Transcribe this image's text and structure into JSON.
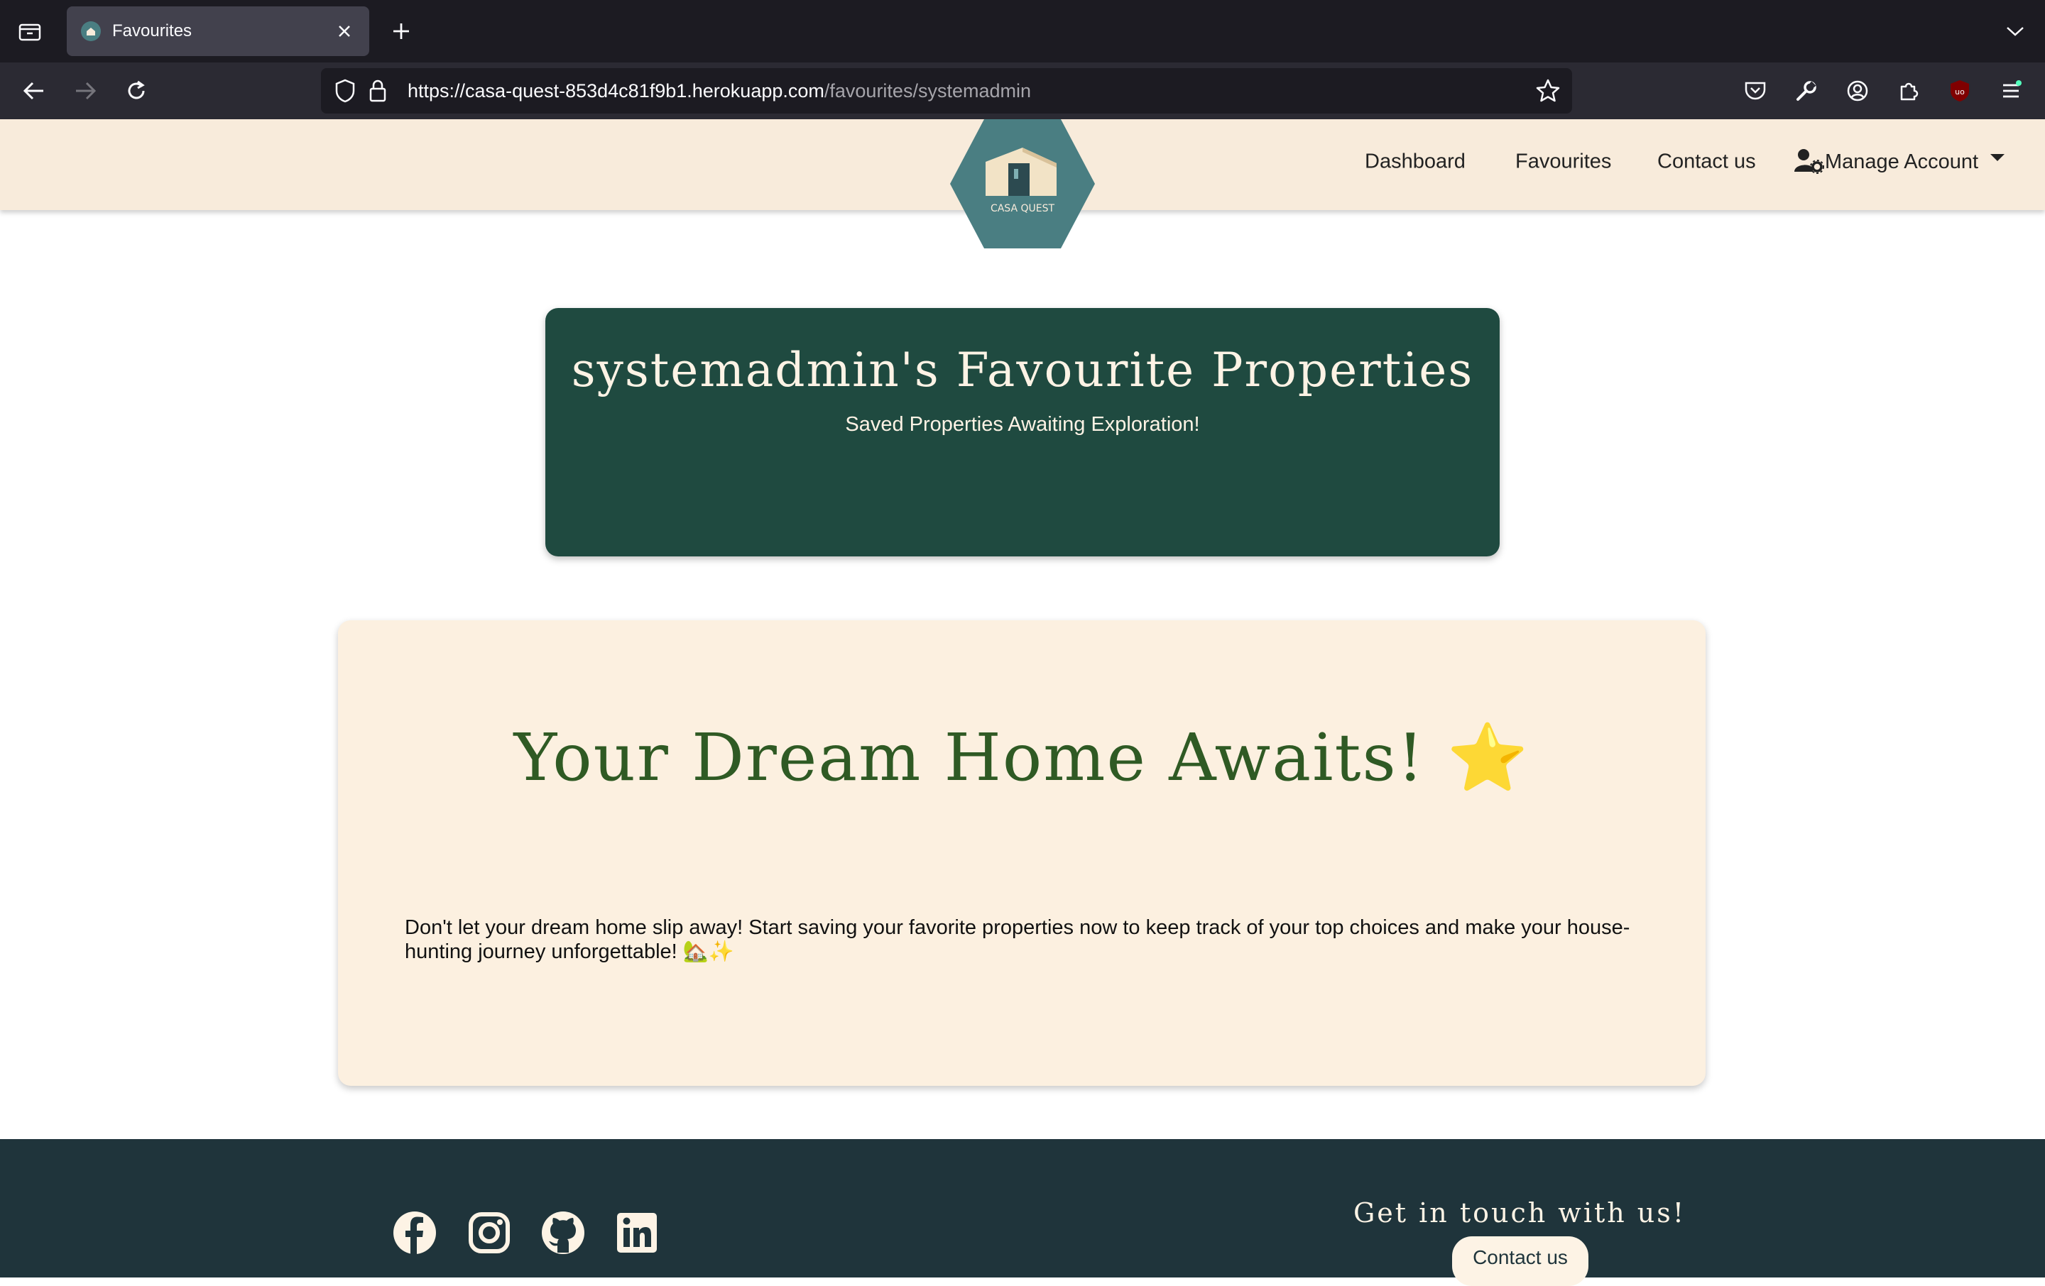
{
  "browser": {
    "tab_title": "Favourites",
    "url_host": "https://casa-quest-853d4c81f9b1.herokuapp.com",
    "url_path": "/favourites/systemadmin"
  },
  "header": {
    "logo_text": "CASA QUEST",
    "nav": {
      "dashboard": "Dashboard",
      "favourites": "Favourites",
      "contact": "Contact us",
      "manage_account": "Manage Account"
    }
  },
  "hero": {
    "title": "systemadmin's Favourite Properties",
    "subtitle": "Saved Properties Awaiting Exploration!"
  },
  "empty_state": {
    "title": "Your Dream Home Awaits! ⭐",
    "message": "Don't let your dream home slip away! Start saving your favorite properties now to keep track of your top choices and make your house-hunting journey unforgettable! 🏡✨"
  },
  "footer": {
    "heading": "Get in touch with us!",
    "contact_button": "Contact us"
  },
  "colors": {
    "header_bg": "#f8ebdb",
    "hero_bg": "#1f4a40",
    "card_bg": "#fcf0e0",
    "title_green": "#2f5a24",
    "footer_bg": "#1f343b",
    "logo_teal": "#4a7e82"
  }
}
